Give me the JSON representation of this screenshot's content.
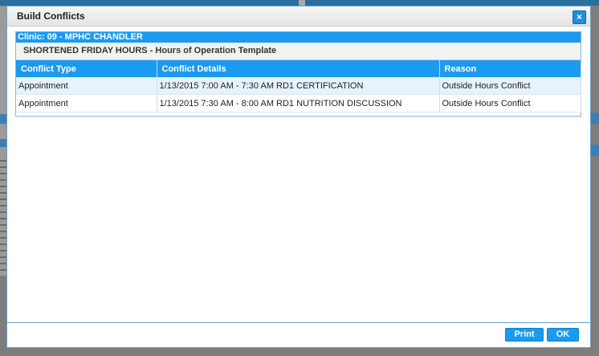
{
  "dialog": {
    "title": "Build Conflicts",
    "close_label": "×"
  },
  "clinic": {
    "label": "Clinic: 09 - MPHC CHANDLER"
  },
  "template": {
    "label": "SHORTENED FRIDAY HOURS - Hours of Operation Template"
  },
  "table": {
    "headers": [
      "Conflict Type",
      "Conflict Details",
      "Reason"
    ],
    "rows": [
      [
        "Appointment",
        "1/13/2015 7:00 AM - 7:30 AM RD1 CERTIFICATION",
        "Outside Hours Conflict"
      ],
      [
        "Appointment",
        "1/13/2015 7:30 AM - 8:00 AM RD1 NUTRITION DISCUSSION",
        "Outside Hours Conflict"
      ]
    ]
  },
  "buttons": {
    "print": "Print",
    "ok": "OK"
  },
  "colors": {
    "accent": "#1a9bf0",
    "row_alt": "#e6f3fc"
  }
}
